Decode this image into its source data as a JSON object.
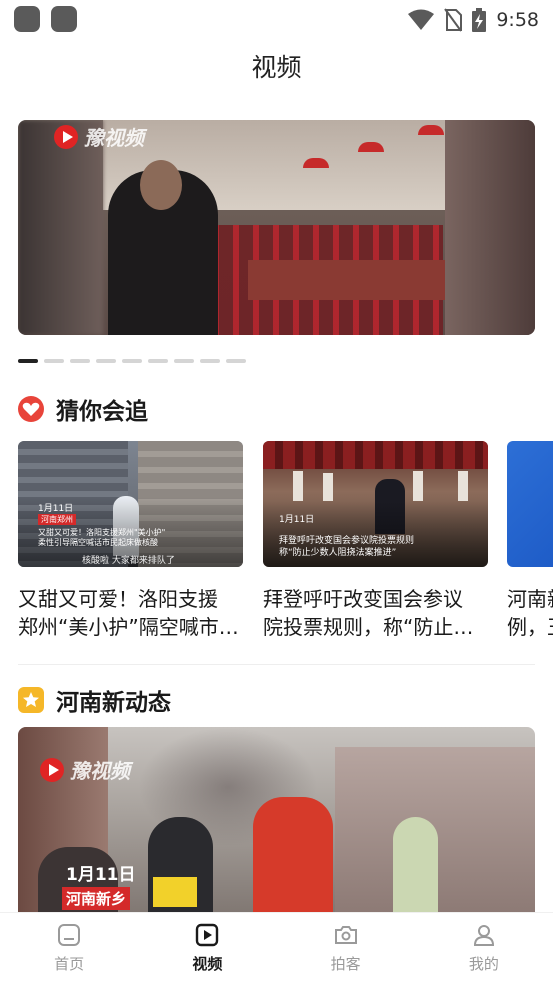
{
  "status_bar": {
    "time": "9:58"
  },
  "header": {
    "title": "视频"
  },
  "banner": {
    "brand": "豫视频",
    "slide_count": 9,
    "active_index": 0
  },
  "recommend": {
    "title": "猜你会追",
    "cards": [
      {
        "thumb_date": "1月11日",
        "thumb_tag": "河南郑州",
        "thumb_caption_1": "又甜又可爱！洛阳支援郑州\"美小护\"",
        "thumb_caption_2": "柔性引导隔空喊话市民起床做核酸",
        "thumb_bottom": "核酸啦 大家都来排队了",
        "title_line1": "又甜又可爱！洛阳支援",
        "title_line2": "郑州“美小护”隔空喊市…"
      },
      {
        "thumb_date": "1月11日",
        "thumb_caption_1": "拜登呼吁改变国会参议院投票规则",
        "thumb_caption_2": "称“防止少数人阻挠法案推进”",
        "title_line1": "拜登呼吁改变国会参议",
        "title_line2": "院投票规则，称“防止…"
      },
      {
        "title_line1": "河南新",
        "title_line2": "例，王"
      }
    ]
  },
  "news": {
    "title": "河南新动态",
    "video": {
      "brand": "豫视频",
      "date": "1月11日",
      "place": "河南新乡"
    }
  },
  "bottom_nav": {
    "items": [
      {
        "label": "首页",
        "icon": "home-icon"
      },
      {
        "label": "视频",
        "icon": "video-icon"
      },
      {
        "label": "拍客",
        "icon": "camera-icon"
      },
      {
        "label": "我的",
        "icon": "user-icon"
      }
    ],
    "active": "视频"
  },
  "colors": {
    "accent_red": "#e8443a",
    "star_yellow": "#f5b728",
    "active_text": "#1a1a1a",
    "inactive_text": "#9a9a9a"
  }
}
